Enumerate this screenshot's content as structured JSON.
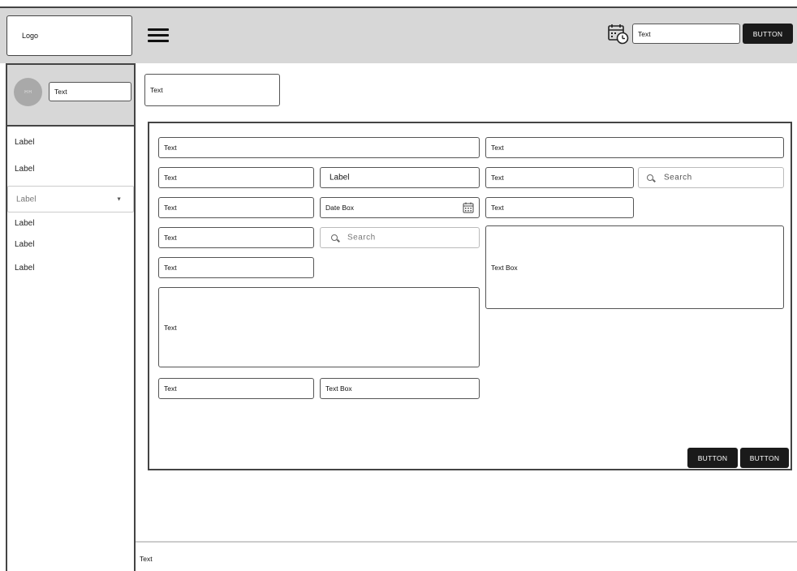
{
  "header": {
    "logo_text": "Logo",
    "input_value": "Text",
    "button_label": "BUTTON",
    "icons": [
      "menu-icon",
      "calendar-clock-icon"
    ]
  },
  "sidebar": {
    "avatar_initials": "H H",
    "user_input_value": "Text",
    "items": [
      {
        "label": "Label"
      },
      {
        "label": "Label"
      },
      {
        "label": "Label",
        "type": "dropdown"
      },
      {
        "label": "Label"
      },
      {
        "label": "Label"
      },
      {
        "label": "Label"
      }
    ]
  },
  "main": {
    "title_box_text": "Text",
    "form": {
      "left": {
        "row1": "Text",
        "row2_input": "Text",
        "row2_label": "Label",
        "row3_input": "Text",
        "row3_date": "Date Box",
        "row4_input": "Text",
        "row4_search_placeholder": "Search",
        "row5_input": "Text",
        "textarea": "Text",
        "row7_input": "Text",
        "row7_textbox": "Text Box"
      },
      "right": {
        "row1": "Text",
        "row2_input": "Text",
        "row2_search_placeholder": "Search",
        "row3_input": "Text",
        "textbox": "Text Box"
      },
      "buttons": [
        "BUTTON",
        "BUTTON"
      ]
    }
  },
  "footer": {
    "text": "Text"
  }
}
